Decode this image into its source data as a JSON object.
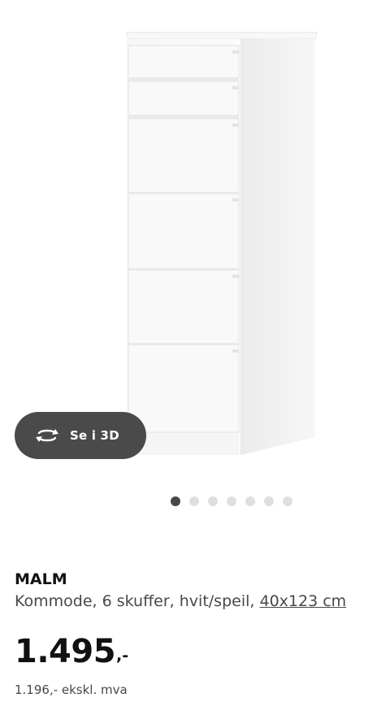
{
  "gallery": {
    "image_alt": "MALM Kommode, 6 skuffer, hvit/speil",
    "view_3d_label": "Se i 3D",
    "dot_count": 7,
    "active_dot": 1
  },
  "product": {
    "name": "MALM",
    "description": "Kommode, 6 skuffer, hvit/speil,",
    "size": "40x123 cm",
    "price": "1.495",
    "price_suffix": ",-",
    "price_ex_vat": "1.196,- ekskl. mva"
  },
  "colors": {
    "button_bg": "#4a4a4a",
    "dot_active": "#484848",
    "dot_inactive": "#dfdfdf",
    "text_primary": "#111111",
    "text_secondary": "#484848"
  },
  "icons": {
    "view_3d": "rotate-3d-icon"
  }
}
